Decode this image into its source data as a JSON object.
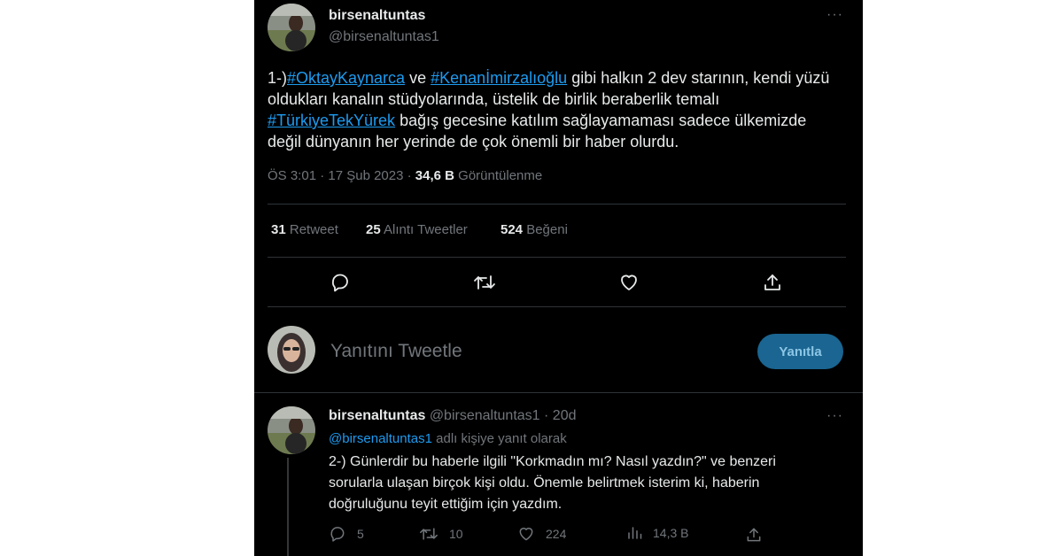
{
  "main_tweet": {
    "author_name": "birsenaltuntas",
    "author_handle": "@birsenaltuntas1",
    "more_label": "···",
    "text_parts": {
      "p1": "1-)",
      "tag1": "#OktayKaynarca",
      "p2": " ve ",
      "tag2": "#Kenanİmirzalıoğlu",
      "p3": " gibi halkın 2 dev starının, kendi yüzü oldukları kanalın stüdyolarında, üstelik de birlik beraberlik temalı ",
      "tag3": "#TürkiyeTekYürek",
      "p4": " bağış gecesine katılım sağlayamaması sadece ülkemizde değil dünyanın her yerinde de çok önemli bir haber olurdu."
    },
    "timestamp": "ÖS 3:01 · 17 Şub 2023",
    "separator": " · ",
    "views_count": "34,6 B",
    "views_label": "Görüntülenme",
    "stats": {
      "retweets_count": "31",
      "retweets_label": "Retweet",
      "quotes_count": "25",
      "quotes_label": "Alıntı Tweetler",
      "likes_count": "524",
      "likes_label": "Beğeni"
    }
  },
  "reply_box": {
    "placeholder": "Yanıtını Tweetle",
    "button_label": "Yanıtla"
  },
  "reply_tweet": {
    "author_name": "birsenaltuntas",
    "author_handle": "@birsenaltuntas1",
    "time": "· 20d",
    "more_label": "···",
    "replying_to_handle": "@birsenaltuntas1",
    "replying_to_suffix": " adlı kişiye yanıt olarak",
    "text": "2-) Günlerdir bu haberle ilgili \"Korkmadın mı? Nasıl yazdın?\" ve benzeri sorularla ulaşan birçok kişi oldu. Önemle belirtmek isterim ki, haberin doğruluğunu teyit ettiğim için yazdım.",
    "actions": {
      "replies": "5",
      "retweets": "10",
      "likes": "224",
      "views": "14,3 B"
    }
  },
  "colors": {
    "background": "#000000",
    "text": "#e7e9ea",
    "secondary": "#71767b",
    "link": "#1d9bf0",
    "button_bg": "#1a6591"
  },
  "icons": [
    "reply-icon",
    "retweet-icon",
    "like-icon",
    "share-icon",
    "views-icon",
    "more-icon"
  ]
}
